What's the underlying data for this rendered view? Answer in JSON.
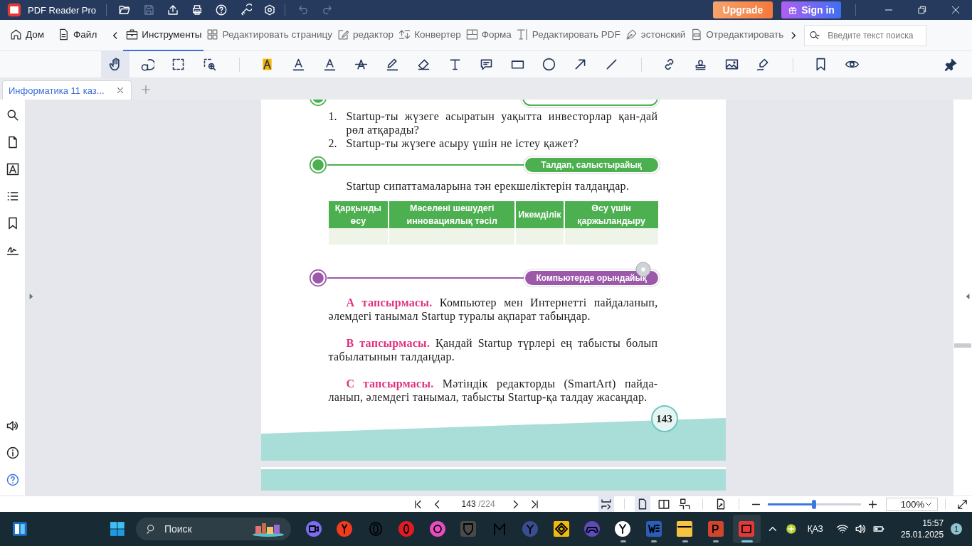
{
  "title_bar": {
    "app_name": "PDF Reader Pro",
    "upgrade_button": "Upgrade",
    "sign_in_button": "Sign in"
  },
  "ribbon": {
    "tabs": [
      {
        "label": "Дом",
        "selected": false
      },
      {
        "label": "Файл",
        "selected": false
      },
      {
        "label": "Инструменты",
        "selected": true
      },
      {
        "label": "Редактировать страницу",
        "selected": false
      },
      {
        "label": "редактор",
        "selected": false
      },
      {
        "label": "Конвертер",
        "selected": false
      },
      {
        "label": "Форма",
        "selected": false
      },
      {
        "label": "Редактировать PDF",
        "selected": false
      },
      {
        "label": "эстонский",
        "selected": false
      },
      {
        "label": "Отредактировать",
        "selected": false
      }
    ],
    "search": {
      "placeholder": "Введите текст поиска"
    }
  },
  "toolbar": {
    "tools": [
      {
        "selected": true
      },
      {
        "selected": false
      },
      {
        "selected": false
      },
      {
        "selected": false
      },
      {
        "selected": false
      },
      {
        "selected": false
      },
      {
        "selected": false
      },
      {
        "selected": false
      },
      {
        "selected": false
      },
      {
        "selected": false
      },
      {
        "selected": false
      },
      {
        "selected": false
      },
      {
        "selected": false
      },
      {
        "selected": false
      },
      {
        "selected": false
      },
      {
        "selected": false
      },
      {
        "selected": false
      },
      {
        "selected": false
      },
      {
        "selected": false
      },
      {
        "selected": false
      },
      {
        "selected": false
      },
      {
        "selected": false
      }
    ]
  },
  "document_tabs": [
    {
      "label": "Информатика 11 каз...",
      "selected": true
    }
  ],
  "page": {
    "questions": [
      {
        "number": "1.",
        "text": "Startup-ты жүзеге асыратын уақытта инвесторлар қан-дай рөл атқарады?"
      },
      {
        "number": "2.",
        "text": "Startup-ты жүзеге асыру үшін не істеу қажет?"
      }
    ],
    "sections": [
      {
        "kind": "analysis",
        "banner": "Талдап, салыстырайық",
        "color": "#4caf50",
        "intro": "Startup сипаттамаларына тән ерекшеліктерін талдаңдар.",
        "table": {
          "columns": [
            "Қарқынды өсу",
            "Мәселені шешудегі инновациялық тәсіл",
            "Икемділік",
            "Өсу үшін қаржыландыру"
          ]
        }
      },
      {
        "kind": "computer",
        "banner": "Компьютерде орындайық",
        "color": "#9c59a9",
        "tasks": [
          "**А тапсырмасы.** Компьютер мен Интернетті пайдаланып, әлемдегі танымал Startup туралы ақпарат табыңдар.",
          "**В тапсырмасы.** Қандай Startup түрлері ең табысты болып табылатынын талдаңдар.",
          "**С тапсырмасы.** Мәтіндік редакторды (SmartArt) пайда-ланып, әлемдегі танымал, табысты Startup-қа талдау жасаңдар."
        ]
      }
    ],
    "page_number": "143"
  },
  "status_bar": {
    "page_input": "143",
    "page_total": "/224",
    "view_buttons": [
      {
        "selected": true
      },
      {
        "selected": true
      },
      {
        "selected": false
      },
      {
        "selected": false
      },
      {
        "selected": false
      }
    ],
    "zoom": {
      "level": 0.5,
      "value": "100%"
    }
  },
  "taskbar": {
    "search_placeholder": "Поиск",
    "apps": [
      {
        "running": false,
        "active": false
      },
      {
        "running": false,
        "active": false
      },
      {
        "running": false,
        "active": false
      },
      {
        "running": false,
        "active": false
      },
      {
        "running": false,
        "active": false
      },
      {
        "running": false,
        "active": false
      },
      {
        "running": false,
        "active": false
      },
      {
        "running": false,
        "active": false
      },
      {
        "running": false,
        "active": false
      },
      {
        "running": false,
        "active": false
      },
      {
        "running": true,
        "active": false
      },
      {
        "running": true,
        "active": false
      },
      {
        "running": true,
        "active": false
      },
      {
        "running": true,
        "active": false
      },
      {
        "running": true,
        "active": true
      }
    ],
    "language": "ҚАЗ",
    "time": "15:57",
    "date": "25.01.2025",
    "notification_count": "1"
  }
}
